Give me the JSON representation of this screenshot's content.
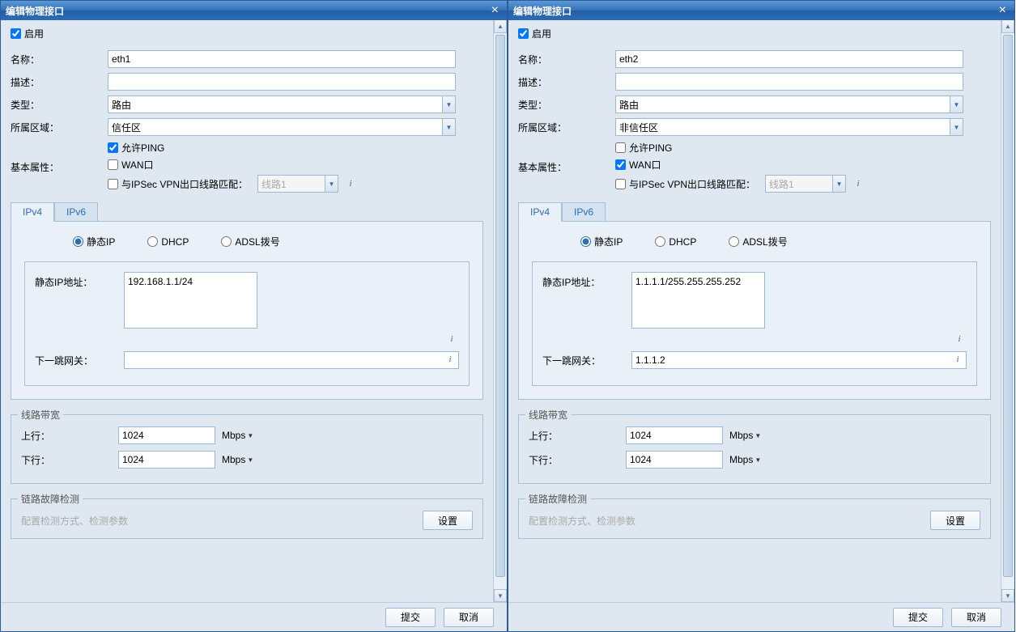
{
  "shared": {
    "title": "编辑物理接口",
    "enable": "启用",
    "labels": {
      "name": "名称：",
      "desc": "描述：",
      "type": "类型：",
      "zone": "所属区域：",
      "basic": "基本属性："
    },
    "checks": {
      "ping": "允许PING",
      "wan": "WAN口",
      "ipsec": "与IPSec VPN出口线路匹配："
    },
    "ipsec_line": "线路1",
    "tabs": {
      "ipv4": "IPv4",
      "ipv6": "IPv6"
    },
    "radios": {
      "static": "静态IP",
      "dhcp": "DHCP",
      "adsl": "ADSL拨号"
    },
    "ip_label": "静态IP地址：",
    "gw_label": "下一跳网关：",
    "bandwidth": {
      "legend": "线路带宽",
      "up": "上行：",
      "down": "下行：",
      "unit": "Mbps"
    },
    "detect": {
      "legend": "链路故障检测",
      "text": "配置检测方式、检测参数",
      "btn": "设置"
    },
    "footer": {
      "submit": "提交",
      "cancel": "取消"
    },
    "type_value": "路由",
    "bw_value": "1024"
  },
  "left": {
    "name_value": "eth1",
    "zone_value": "信任区",
    "ping": true,
    "wan": false,
    "ipsec": false,
    "ip_value": "192.168.1.1/24",
    "gw_value": ""
  },
  "right": {
    "name_value": "eth2",
    "zone_value": "非信任区",
    "ping": false,
    "wan": true,
    "ipsec": false,
    "ip_value": "1.1.1.1/255.255.255.252",
    "gw_value": "1.1.1.2"
  }
}
